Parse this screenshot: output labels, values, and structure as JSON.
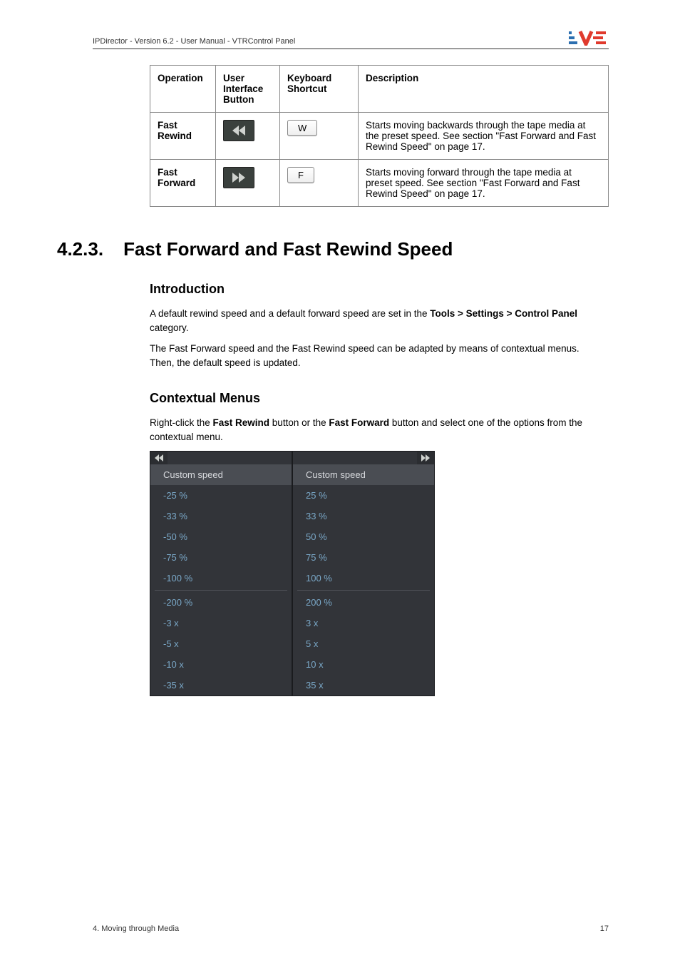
{
  "header": {
    "doc_title": "IPDirector - Version 6.2 - User Manual - VTRControl Panel",
    "logo_alt": "EVS"
  },
  "table": {
    "headers": {
      "operation": "Operation",
      "ui_button": "User Interface Button",
      "shortcut": "Keyboard Shortcut",
      "description": "Description"
    },
    "rows": [
      {
        "operation": "Fast Rewind",
        "key": "W",
        "description": "Starts moving backwards through the tape media at the preset speed. See section \"Fast Forward and Fast Rewind Speed\" on page 17."
      },
      {
        "operation": "Fast Forward",
        "key": "F",
        "description": "Starts moving forward through the tape media at preset speed. See section \"Fast Forward and Fast Rewind Speed\" on page 17."
      }
    ]
  },
  "section": {
    "number": "4.2.3.",
    "title": "Fast Forward and Fast Rewind Speed",
    "intro_heading": "Introduction",
    "intro_p1_a": "A default rewind speed and a default forward speed are set in the ",
    "intro_p1_b": "Tools > Settings > Control Panel",
    "intro_p1_c": " category.",
    "intro_p2": "The Fast Forward speed and the Fast Rewind speed can be adapted by means of contextual menus. Then, the default speed is updated.",
    "ctx_heading": "Contextual Menus",
    "ctx_p_a": "Right-click the ",
    "ctx_p_b": "Fast Rewind",
    "ctx_p_c": " button or the ",
    "ctx_p_d": "Fast Forward",
    "ctx_p_e": " button and select one of the options from the contextual menu."
  },
  "menus": {
    "left": {
      "header_label": "Custom speed",
      "items": [
        "-25 %",
        "-33 %",
        "-50 %",
        "-75 %",
        "-100 %",
        "__sep__",
        "-200 %",
        "-3 x",
        "-5 x",
        "-10 x",
        "-35 x"
      ]
    },
    "right": {
      "header_label": "Custom speed",
      "items": [
        "25 %",
        "33 %",
        "50 %",
        "75 %",
        "100 %",
        "__sep__",
        "200 %",
        "3 x",
        "5 x",
        "10 x",
        "35 x"
      ]
    }
  },
  "footer": {
    "left": "4. Moving through Media",
    "right": "17"
  }
}
